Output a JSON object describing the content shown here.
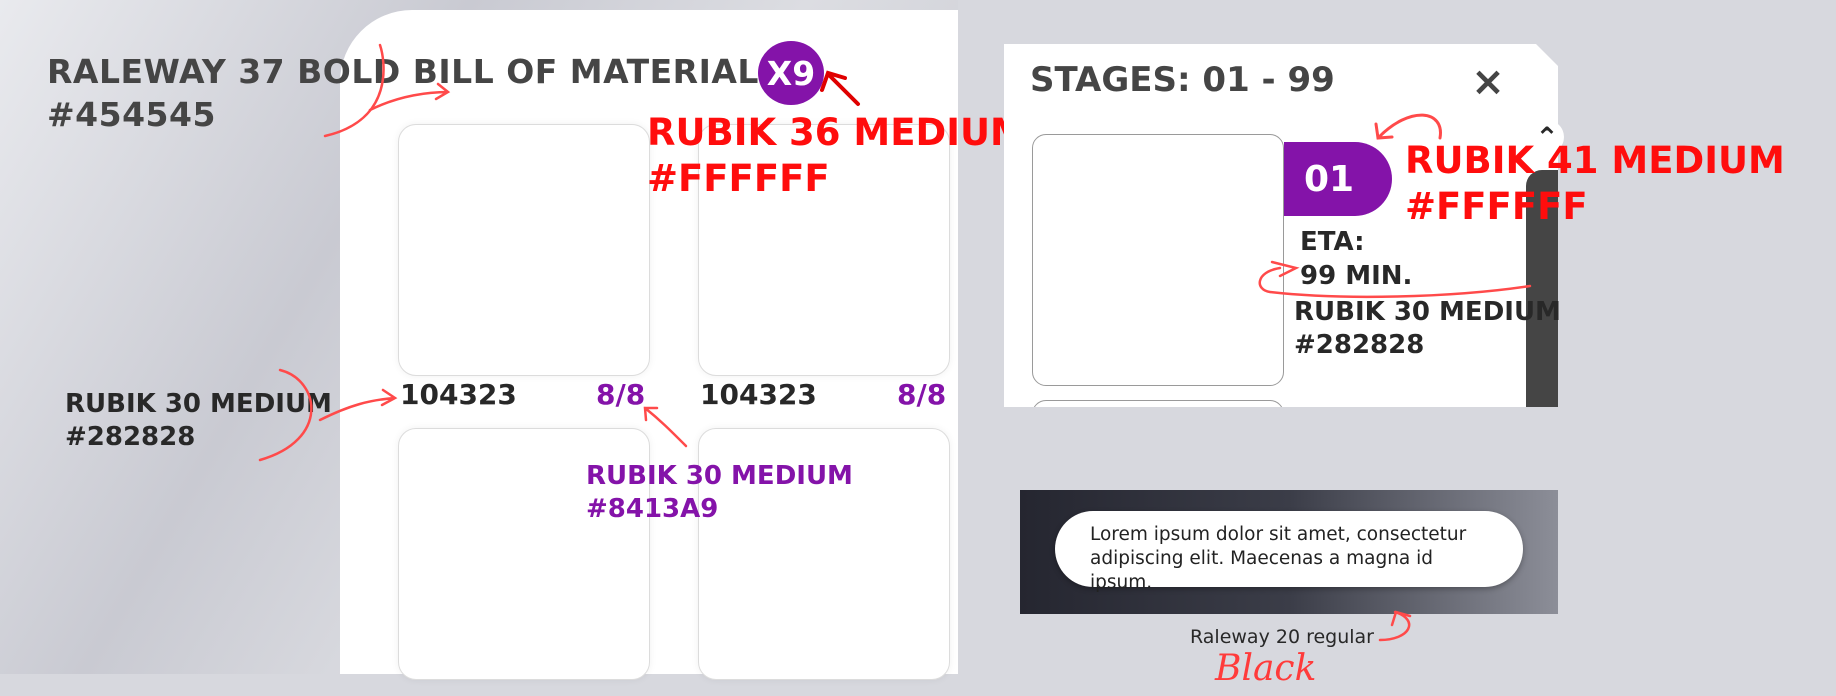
{
  "bom": {
    "title": "RALEWAY 37 BOLD BILL OF MATERIALS",
    "title_color_hex": "#454545",
    "badge": "X9",
    "parts": [
      {
        "id": "104323",
        "count": "8/8"
      },
      {
        "id": "104323",
        "count": "8/8"
      }
    ]
  },
  "annotations": {
    "badge_font": "RUBIK 36 MEDIUM",
    "badge_color": "#FFFFFF",
    "part_id_font": "RUBIK 30 MEDIUM",
    "part_id_color": "#282828",
    "part_count_font": "RUBIK 30 MEDIUM",
    "part_count_color": "#8413A9",
    "stage_pill_font": "RUBIK 41 MEDIUM",
    "stage_pill_color": "#FFFFFF",
    "eta_font": "RUBIK 30 MEDIUM",
    "eta_color": "#282828",
    "toast_caption": "Raleway 20 regular",
    "toast_caption_note": "Black"
  },
  "stages": {
    "title": "STAGES:  01 - 99",
    "close_icon": "×",
    "stage_number": "01",
    "eta_label": "ETA:",
    "eta_value": "99 MIN.",
    "scroll_up_icon": "⌃"
  },
  "toast": {
    "message": "Lorem ipsum dolor sit amet, consectetur adipiscing elit. Maecenas a magna id ipsum."
  },
  "colors": {
    "accent": "#8413A9",
    "title": "#454545",
    "text": "#282828",
    "annotation": "#FF0D0D"
  }
}
